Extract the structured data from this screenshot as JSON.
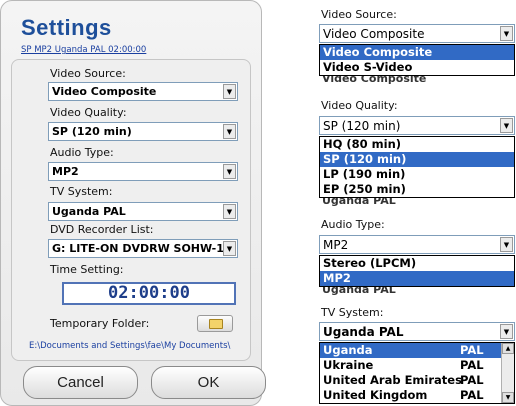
{
  "settings": {
    "title": "Settings",
    "subtitle": "SP MP2 Uganda  PAL 02:00:00",
    "video_source_label": "Video Source:",
    "video_source_value": "Video Composite",
    "video_quality_label": "Video Quality:",
    "video_quality_value": "SP (120 min)",
    "audio_type_label": "Audio Type:",
    "audio_type_value": "MP2",
    "tv_system_label": "TV System:",
    "tv_system_value": "Uganda  PAL",
    "dvd_recorder_label": "DVD Recorder List:",
    "dvd_recorder_value": "G: LITE-ON DVDRW SOHW-16:",
    "time_setting_label": "Time Setting:",
    "time_value": "02:00:00",
    "temp_folder_label": "Temporary Folder:",
    "temp_folder_path": "E:\\Documents and Settings\\fae\\My Documents\\",
    "cancel_label": "Cancel",
    "ok_label": "OK"
  },
  "dropdowns": {
    "video_source": {
      "label": "Video Source:",
      "value": "Video Composite",
      "options": [
        "Video Composite",
        "Video S-Video"
      ],
      "peek": "Video Composite"
    },
    "video_quality": {
      "label": "Video Quality:",
      "value": "SP (120 min)",
      "options": [
        "HQ (80 min)",
        "SP (120 min)",
        "LP (190 min)",
        "EP (250 min)"
      ],
      "peek": "Uganda  PAL"
    },
    "audio_type": {
      "label": "Audio Type:",
      "value": "MP2",
      "options": [
        "Stereo (LPCM)",
        "MP2"
      ],
      "peek": "Uganda  PAL"
    },
    "tv_system": {
      "label": "TV System:",
      "value": "Uganda  PAL",
      "options": [
        {
          "country": "Uganda",
          "system": "PAL"
        },
        {
          "country": "Ukraine",
          "system": "PAL"
        },
        {
          "country": "United Arab Emirates",
          "system": "PAL"
        },
        {
          "country": "United Kingdom",
          "system": "PAL"
        }
      ]
    }
  },
  "icons": {
    "dropdown_arrow": "▼",
    "scroll_up": "▲",
    "scroll_down": "▼",
    "folder": "folder-icon"
  },
  "colors": {
    "title": "#1e4f9a",
    "selection": "#316ac5",
    "time_border": "#5173b6"
  }
}
